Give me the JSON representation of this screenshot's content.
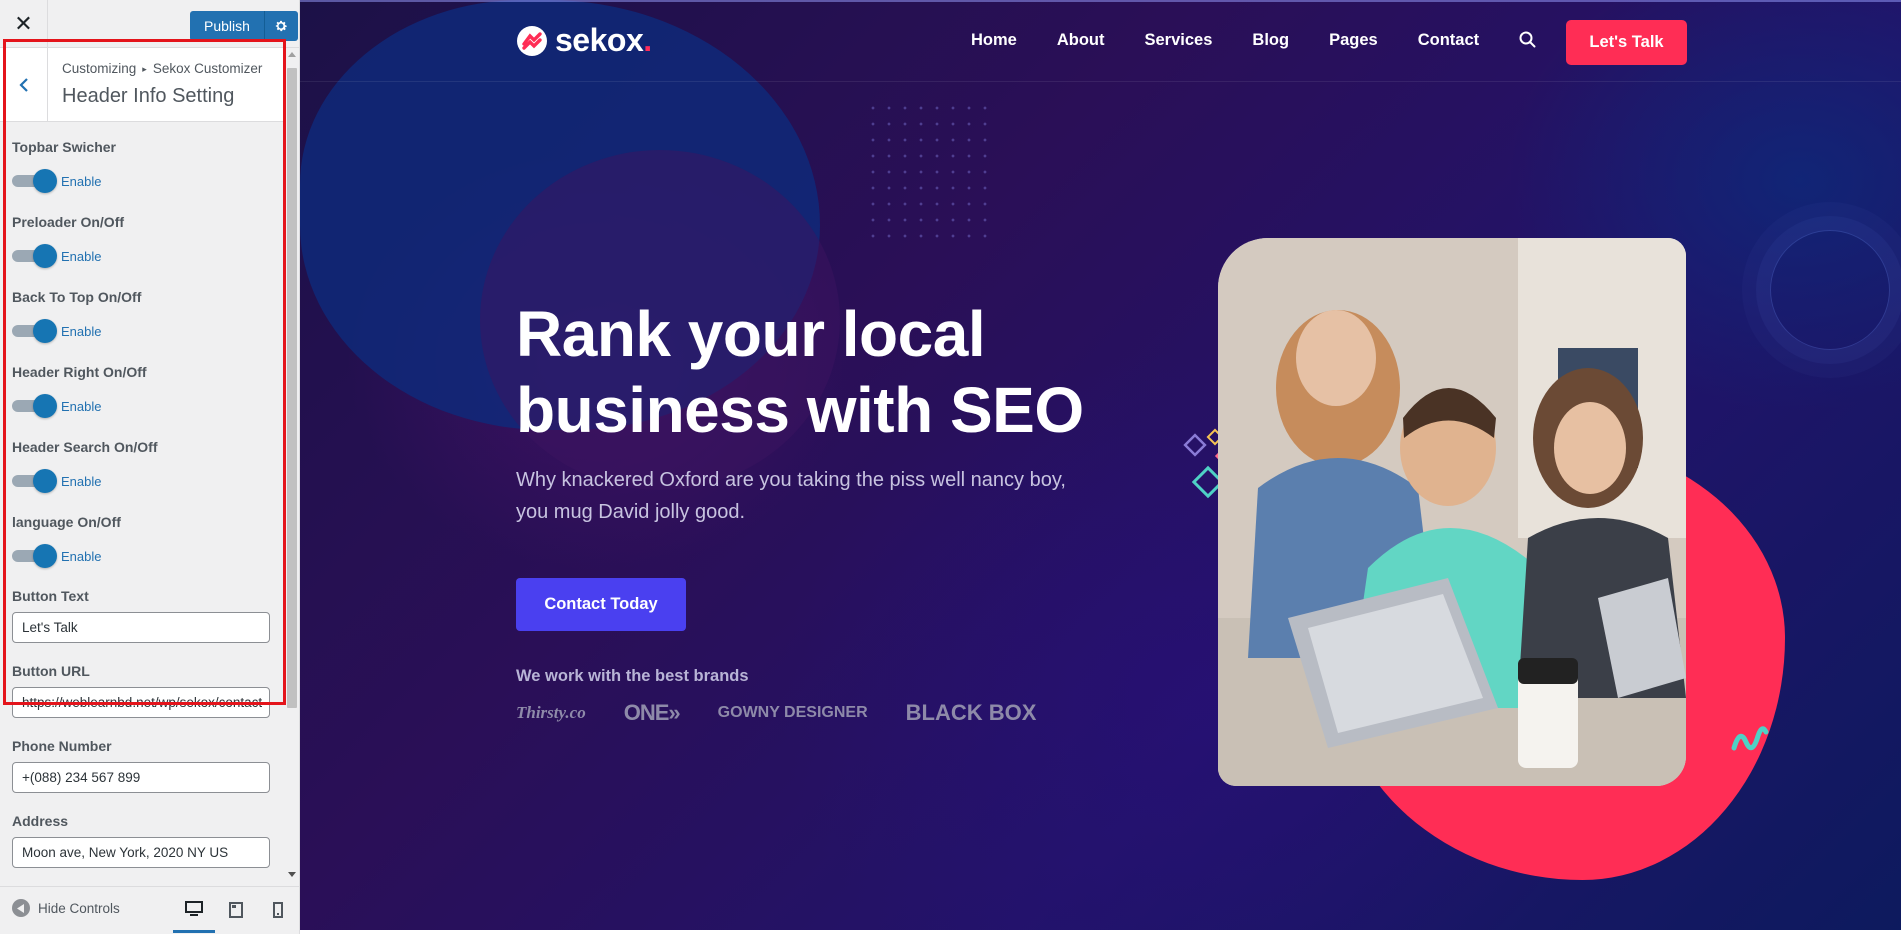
{
  "customizer": {
    "close_icon": "close-icon",
    "publish_label": "Publish",
    "breadcrumb": [
      "Customizing",
      "Sekox Customizer"
    ],
    "section_title": "Header Info Setting",
    "toggles": [
      {
        "label": "Topbar Swicher",
        "state": "Enable"
      },
      {
        "label": "Preloader On/Off",
        "state": "Enable"
      },
      {
        "label": "Back To Top On/Off",
        "state": "Enable"
      },
      {
        "label": "Header Right On/Off",
        "state": "Enable"
      },
      {
        "label": "Header Search On/Off",
        "state": "Enable"
      },
      {
        "label": "language On/Off",
        "state": "Enable"
      }
    ],
    "fields": [
      {
        "label": "Button Text",
        "value": "Let's Talk"
      },
      {
        "label": "Button URL",
        "value": "https://weblearnbd.net/wp/sekox/contact"
      },
      {
        "label": "Phone Number",
        "value": "+(088) 234 567 899"
      },
      {
        "label": "Address",
        "value": "Moon ave, New York, 2020 NY US"
      }
    ],
    "footer": {
      "hide_controls_label": "Hide Controls",
      "devices": [
        "desktop",
        "tablet",
        "mobile"
      ],
      "active_device": "desktop"
    },
    "accent_color": "#2271b1",
    "highlight_color": "#e4141b"
  },
  "site": {
    "logo_text": "sekox",
    "logo_dot": ".",
    "nav": [
      "Home",
      "About",
      "Services",
      "Blog",
      "Pages",
      "Contact"
    ],
    "cta_label": "Let's Talk",
    "hero_title_line1": "Rank your local",
    "hero_title_line2": "business with SEO",
    "hero_description": "Why knackered Oxford are you taking the piss well nancy boy, you mug David jolly good.",
    "contact_button": "Contact Today",
    "brands_label": "We work with the best brands",
    "brands": [
      "Thirsty.co",
      "ONE",
      "GOWNY DESIGNER",
      "BLACK BOX"
    ],
    "colors": {
      "cta": "#ff2d55",
      "button": "#4a40f0",
      "background": "#1c1147"
    }
  }
}
